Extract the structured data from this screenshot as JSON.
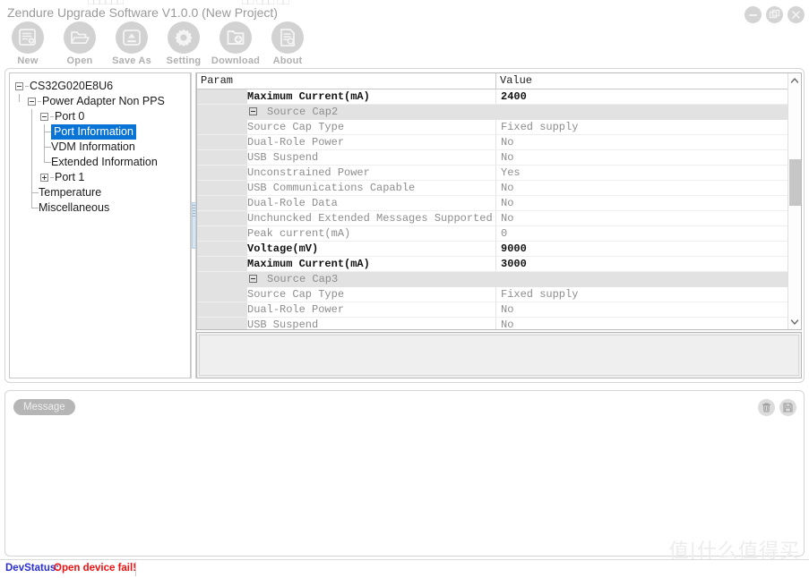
{
  "top_strip": {
    "left_fragment": "□□□□□□",
    "right_fragment": "□□ □□□ □□"
  },
  "window": {
    "title": "Zendure Upgrade Software V1.0.0 (New Project)",
    "controls": [
      {
        "name": "minimize-button",
        "icon": "minimize-icon"
      },
      {
        "name": "maximize-button",
        "icon": "restore-icon"
      },
      {
        "name": "close-button",
        "icon": "close-icon"
      }
    ]
  },
  "toolbar": {
    "items": [
      {
        "label": "New",
        "icon": "new-file-icon"
      },
      {
        "label": "Open",
        "icon": "open-folder-icon"
      },
      {
        "label": "Save As",
        "icon": "save-as-icon"
      },
      {
        "label": "Setting",
        "icon": "gear-icon"
      },
      {
        "label": "Download",
        "icon": "download-icon"
      },
      {
        "label": "About",
        "icon": "about-document-icon"
      }
    ]
  },
  "tree": {
    "nodes": [
      {
        "label": "CS32G020E8U6",
        "depth": 0,
        "expander": "minus",
        "selected": false
      },
      {
        "label": "Power Adapter Non PPS",
        "depth": 1,
        "expander": "minus",
        "selected": false
      },
      {
        "label": "Port 0",
        "depth": 2,
        "expander": "minus",
        "selected": false
      },
      {
        "label": "Port Information",
        "depth": 3,
        "expander": "none",
        "selected": true
      },
      {
        "label": "VDM Information",
        "depth": 3,
        "expander": "none",
        "selected": false
      },
      {
        "label": "Extended Information",
        "depth": 3,
        "expander": "none",
        "selected": false
      },
      {
        "label": "Port 1",
        "depth": 2,
        "expander": "plus",
        "selected": false
      },
      {
        "label": "Temperature",
        "depth": 2,
        "expander": "none",
        "selected": false
      },
      {
        "label": "Miscellaneous",
        "depth": 2,
        "expander": "none",
        "selected": false
      }
    ]
  },
  "grid": {
    "columns": [
      "Param",
      "Value"
    ],
    "rows": [
      {
        "param": "Maximum Current(mA)",
        "value": "2400",
        "style": "bold"
      },
      {
        "param": "Source Cap2",
        "value": "",
        "style": "group"
      },
      {
        "param": "Source Cap Type",
        "value": "Fixed supply",
        "style": "normal"
      },
      {
        "param": "Dual-Role Power",
        "value": "No",
        "style": "normal"
      },
      {
        "param": "USB Suspend",
        "value": "No",
        "style": "normal"
      },
      {
        "param": "Unconstrained Power",
        "value": "Yes",
        "style": "normal"
      },
      {
        "param": "USB Communications Capable",
        "value": "No",
        "style": "normal"
      },
      {
        "param": "Dual-Role Data",
        "value": "No",
        "style": "normal"
      },
      {
        "param": "Unchuncked Extended Messages Supported",
        "value": "No",
        "style": "normal"
      },
      {
        "param": "Peak current(mA)",
        "value": "0",
        "style": "normal"
      },
      {
        "param": "Voltage(mV)",
        "value": "9000",
        "style": "bold"
      },
      {
        "param": "Maximum Current(mA)",
        "value": "3000",
        "style": "bold"
      },
      {
        "param": "Source Cap3",
        "value": "",
        "style": "group"
      },
      {
        "param": "Source Cap Type",
        "value": "Fixed supply",
        "style": "normal"
      },
      {
        "param": "Dual-Role Power",
        "value": "No",
        "style": "normal"
      },
      {
        "param": "USB Suspend",
        "value": "No",
        "style": "normal"
      }
    ],
    "scrollbar": {
      "up_arrow": "chevron-up-icon",
      "down_arrow": "chevron-down-icon"
    }
  },
  "description": {
    "text": ""
  },
  "message_panel": {
    "tab_label": "Message",
    "content": "",
    "buttons": [
      {
        "name": "clear-messages-button",
        "icon": "trash-icon"
      },
      {
        "name": "save-messages-button",
        "icon": "floppy-save-icon"
      }
    ]
  },
  "watermark": {
    "text": "值|什么值得买"
  },
  "status_bar": {
    "label": "DevStatus:",
    "value": "Open device fail!",
    "label_color": "#2b2fd0",
    "value_color": "#f01010"
  }
}
